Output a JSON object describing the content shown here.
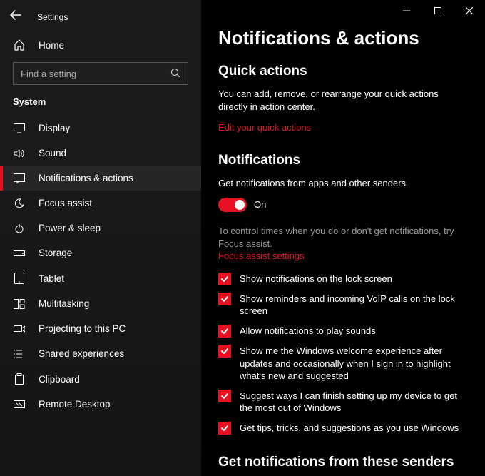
{
  "window": {
    "title": "Settings"
  },
  "sidebar": {
    "home_label": "Home",
    "search_placeholder": "Find a setting",
    "category_label": "System",
    "items": [
      {
        "label": "Display",
        "icon": "display"
      },
      {
        "label": "Sound",
        "icon": "sound"
      },
      {
        "label": "Notifications & actions",
        "icon": "notifications",
        "active": true
      },
      {
        "label": "Focus assist",
        "icon": "moon"
      },
      {
        "label": "Power & sleep",
        "icon": "power"
      },
      {
        "label": "Storage",
        "icon": "storage"
      },
      {
        "label": "Tablet",
        "icon": "tablet"
      },
      {
        "label": "Multitasking",
        "icon": "multitask"
      },
      {
        "label": "Projecting to this PC",
        "icon": "project"
      },
      {
        "label": "Shared experiences",
        "on": "shared"
      },
      {
        "label": "Clipboard",
        "icon": "clipboard"
      },
      {
        "label": "Remote Desktop",
        "icon": "remote"
      }
    ]
  },
  "main": {
    "heading": "Notifications & actions",
    "quick": {
      "heading": "Quick actions",
      "body": "You can add, remove, or rearrange your quick actions directly in action center.",
      "link": "Edit your quick actions"
    },
    "notifications": {
      "heading": "Notifications",
      "toggle_caption": "Get notifications from apps and other senders",
      "toggle_state_label": "On",
      "toggle_on": true,
      "help_text": "To control times when you do or don't get notifications, try Focus assist.",
      "help_link": "Focus assist settings",
      "checks": [
        {
          "label": "Show notifications on the lock screen",
          "checked": true
        },
        {
          "label": "Show reminders and incoming VoIP calls on the lock screen",
          "checked": true
        },
        {
          "label": "Allow notifications to play sounds",
          "checked": true
        },
        {
          "label": "Show me the Windows welcome experience after updates and occasionally when I sign in to highlight what's new and suggested",
          "checked": true
        },
        {
          "label": "Suggest ways I can finish setting up my device to get the most out of Windows",
          "checked": true
        },
        {
          "label": "Get tips, tricks, and suggestions as you use Windows",
          "checked": true
        }
      ]
    },
    "senders_heading": "Get notifications from these senders"
  }
}
